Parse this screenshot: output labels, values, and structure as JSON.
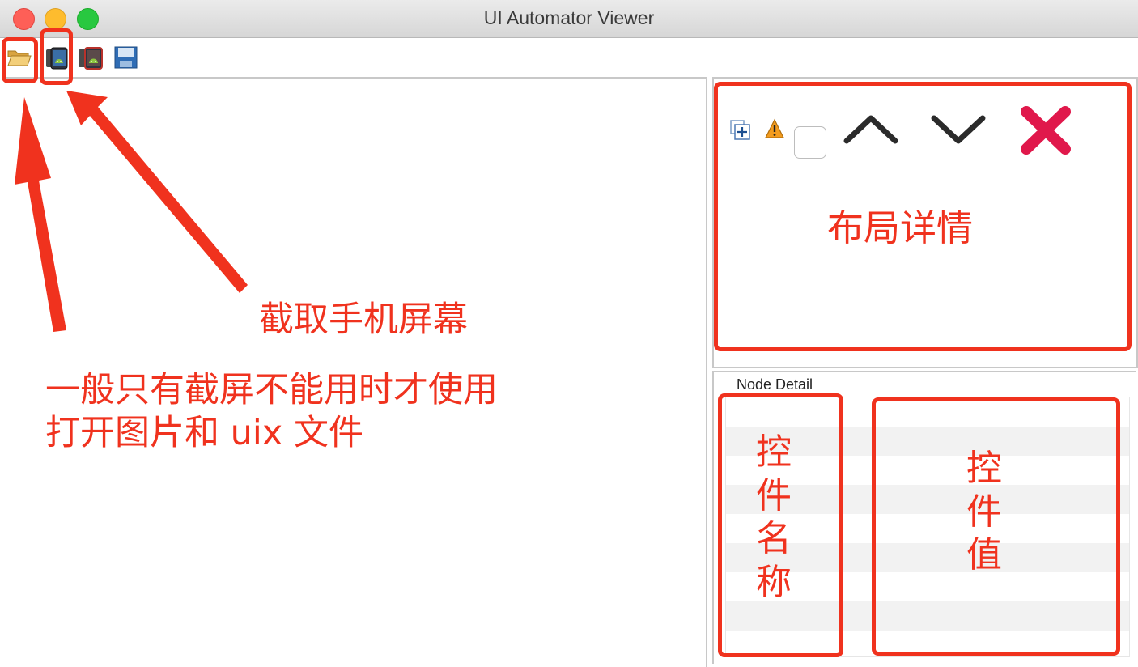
{
  "window": {
    "title": "UI Automator Viewer"
  },
  "toolbar": {
    "icons": [
      "open-folder-icon",
      "device-screenshot-icon",
      "device-screenshot-compressed-icon",
      "save-icon"
    ]
  },
  "layout_panel": {
    "icons": [
      "expand-all-icon",
      "warning-icon",
      "up-arrow-icon",
      "down-arrow-icon",
      "close-x-icon"
    ]
  },
  "node_detail": {
    "label": "Node Detail"
  },
  "annotations": {
    "capture_screen": "截取手机屏幕",
    "open_file_line1": "一般只有截屏不能用时才使用",
    "open_file_line2": "打开图片和 uix 文件",
    "layout_detail": "布局详情",
    "control_name": "控件名称",
    "control_value": "控件值"
  },
  "colors": {
    "annotation_red": "#f0321e"
  }
}
